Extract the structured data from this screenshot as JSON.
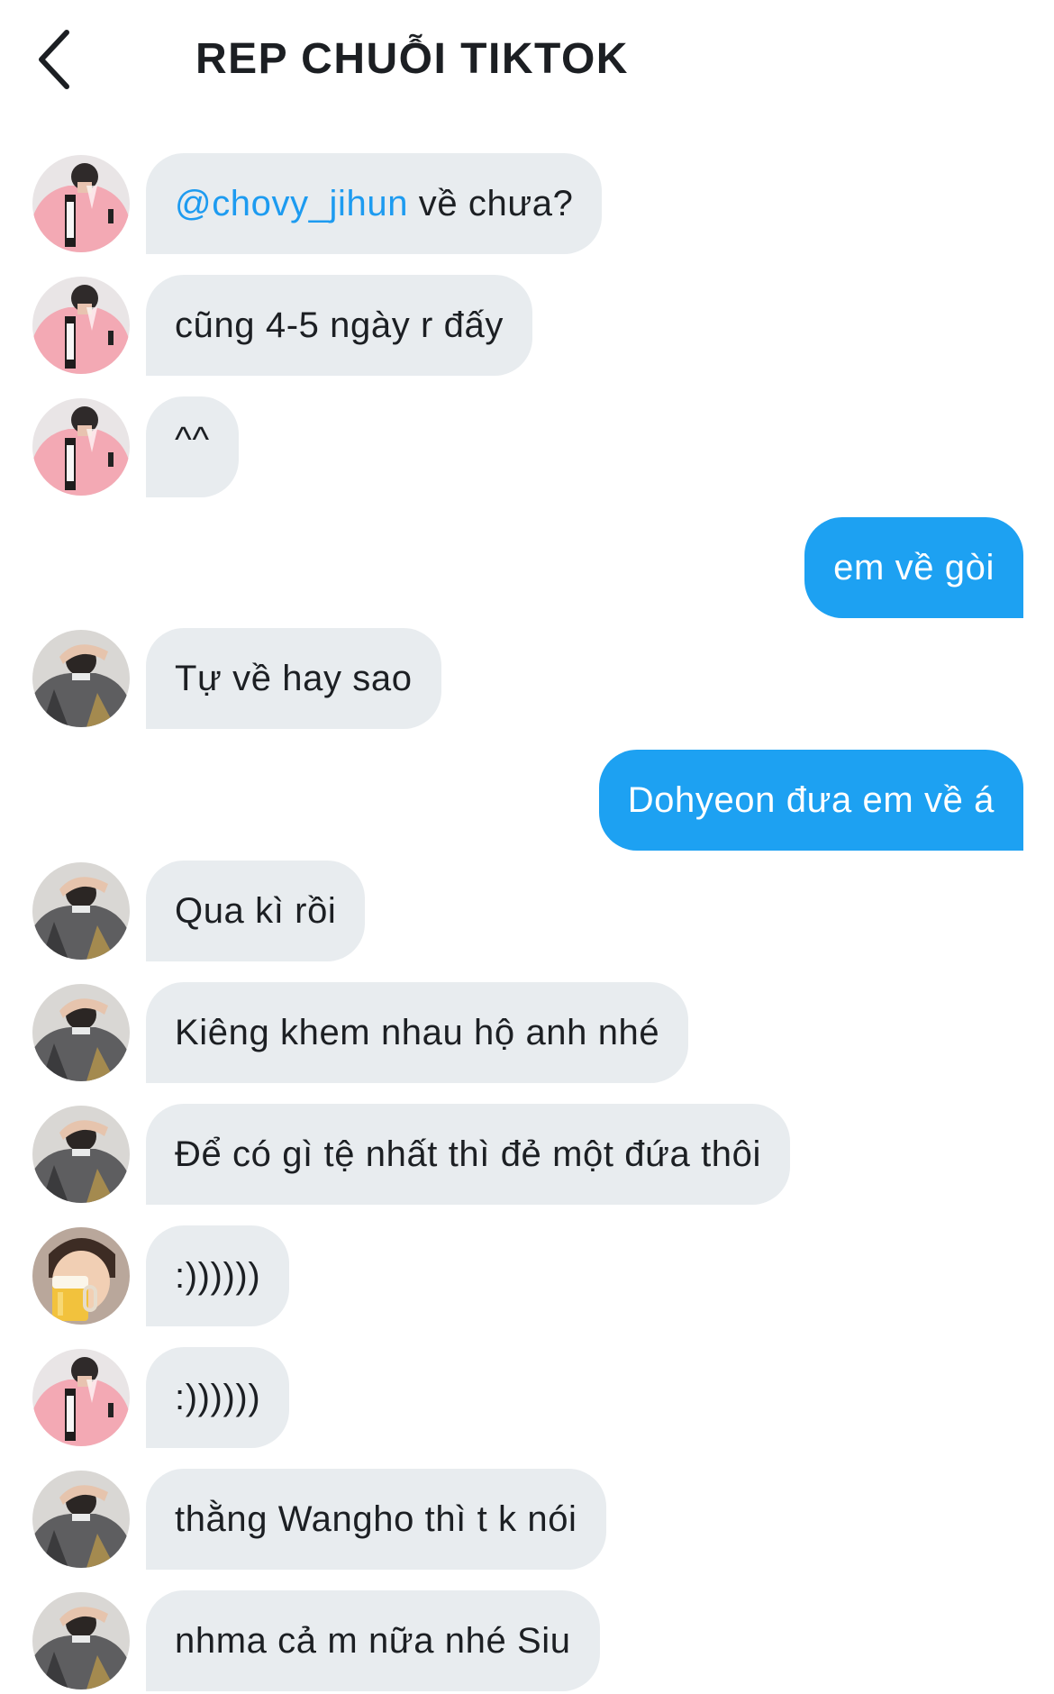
{
  "header": {
    "title": "REP CHUỖI TIKTOK",
    "back_icon": "chevron-left-icon"
  },
  "colors": {
    "incoming_bubble": "#e8ecef",
    "outgoing_bubble": "#1da1f2",
    "mention": "#1d9bf0",
    "text": "#1c1f23"
  },
  "messages": [
    {
      "direction": "incoming",
      "avatar": "pink-jacket-avatar",
      "mention": "@chovy_jihun",
      "text": " về chưa?"
    },
    {
      "direction": "incoming",
      "avatar": "pink-jacket-avatar",
      "text": "cũng 4-5 ngày r đấy"
    },
    {
      "direction": "incoming",
      "avatar": "pink-jacket-avatar",
      "text": "^^"
    },
    {
      "direction": "outgoing",
      "text": "em về gòi"
    },
    {
      "direction": "incoming",
      "avatar": "grey-jersey-avatar",
      "text": "Tự về hay sao"
    },
    {
      "direction": "outgoing",
      "text": "Dohyeon đưa em về á"
    },
    {
      "direction": "incoming",
      "avatar": "grey-jersey-avatar",
      "text": "Qua kì rồi"
    },
    {
      "direction": "incoming",
      "avatar": "grey-jersey-avatar",
      "text": "Kiêng khem nhau hộ anh nhé"
    },
    {
      "direction": "incoming",
      "avatar": "grey-jersey-avatar",
      "text": "Để có gì tệ nhất thì đẻ một đứa thôi"
    },
    {
      "direction": "incoming",
      "avatar": "beer-avatar",
      "text": ":))))))"
    },
    {
      "direction": "incoming",
      "avatar": "pink-jacket-avatar",
      "text": ":))))))"
    },
    {
      "direction": "incoming",
      "avatar": "grey-jersey-avatar",
      "text": "thằng Wangho thì t k nói"
    },
    {
      "direction": "incoming",
      "avatar": "grey-jersey-avatar",
      "text": "nhma cả m nữa nhé Siu"
    }
  ]
}
